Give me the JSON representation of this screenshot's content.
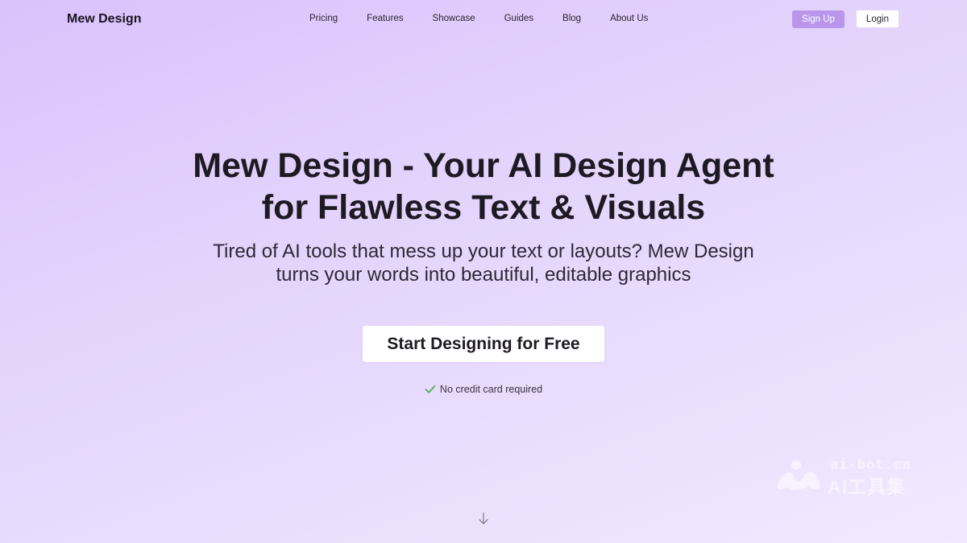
{
  "nav": {
    "logo": "Mew Design",
    "items": [
      {
        "label": "Pricing"
      },
      {
        "label": "Features"
      },
      {
        "label": "Showcase"
      },
      {
        "label": "Guides"
      },
      {
        "label": "Blog"
      },
      {
        "label": "About Us"
      }
    ],
    "signup_label": "Sign Up",
    "login_label": "Login"
  },
  "hero": {
    "title_line1": "Mew Design - Your AI Design Agent",
    "title_line2": "for Flawless Text & Visuals",
    "subtitle_line1": "Tired of AI tools that mess up your text or layouts? Mew Design",
    "subtitle_line2": "turns your words into beautiful, editable graphics",
    "cta_label": "Start Designing for Free",
    "note": "No credit card required"
  },
  "watermark": {
    "line1": "ai-bot.cn",
    "line2": "AI工具集"
  },
  "icons": {
    "check": "check-icon",
    "scroll": "arrow-down-icon",
    "watermark_logo": "watermark-logo-icon"
  },
  "colors": {
    "accent": "#b996ec",
    "check": "#4caf50",
    "background_start": "#d9c2fb",
    "background_end": "#f2e9fe"
  }
}
